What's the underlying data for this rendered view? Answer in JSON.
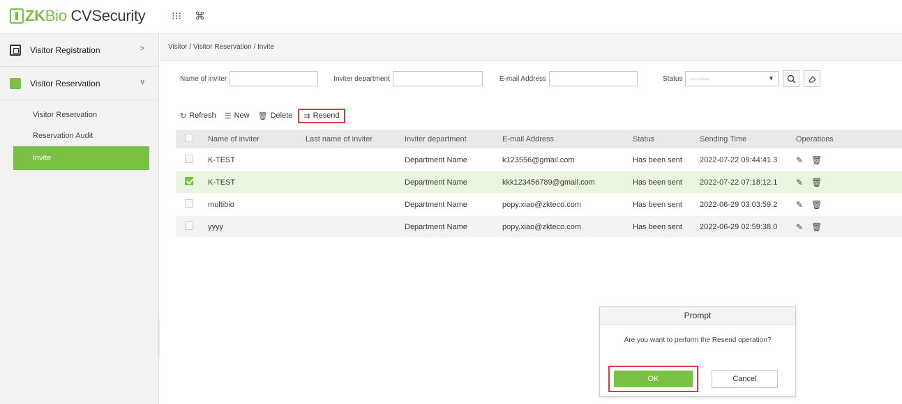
{
  "app": {
    "logo_prefix": "ZK",
    "logo_bio": "Bio",
    "logo_suffix": " CVSecurity"
  },
  "topbar": {
    "apps_icon": "⁝⁝⁝",
    "cmd_icon": "⌘"
  },
  "sidebar": {
    "groups": [
      {
        "label": "Visitor Registration",
        "chevron": ">"
      },
      {
        "label": "Visitor Reservation",
        "chevron": "v"
      }
    ],
    "items": [
      {
        "label": "Visitor Reservation"
      },
      {
        "label": "Reservation Audit"
      },
      {
        "label": "Invite"
      }
    ],
    "collapse": "<"
  },
  "breadcrumb": "Visitor / Visitor Reservation / Invite",
  "filters": {
    "name_label": "Name of inviter",
    "dept_label": "Inviter department",
    "email_label": "E-mail Address",
    "status_label": "Status",
    "status_value": "---------"
  },
  "toolbar": {
    "refresh": "Refresh",
    "new": "New",
    "delete": "Delete",
    "resend": "Resend"
  },
  "table": {
    "headers": [
      "Name of inviter",
      "Last name of inviter",
      "Inviter department",
      "E-mail Address",
      "Status",
      "Sending Time",
      "Operations"
    ],
    "rows": [
      {
        "name": "K-TEST",
        "last": "",
        "dept": "Department Name",
        "email": "k123556@gmail.com",
        "status": "Has been sent",
        "time": "2022-07-22 09:44:41.3",
        "checked": false
      },
      {
        "name": "K-TEST",
        "last": "",
        "dept": "Department Name",
        "email": "kkk123456789@gmail.com",
        "status": "Has been sent",
        "time": "2022-07-22 07:18:12.1",
        "checked": true
      },
      {
        "name": "multibio",
        "last": "",
        "dept": "Department Name",
        "email": "popy.xiao@zkteco.com",
        "status": "Has been sent",
        "time": "2022-06-29 03:03:59.2",
        "checked": false
      },
      {
        "name": "yyyy",
        "last": "",
        "dept": "Department Name",
        "email": "popy.xiao@zkteco.com",
        "status": "Has been sent",
        "time": "2022-06-29 02:59:38.0",
        "checked": false
      }
    ]
  },
  "dialog": {
    "title": "Prompt",
    "message": "Are you want to perform the Resend operation?",
    "ok": "OK",
    "cancel": "Cancel"
  },
  "colors": {
    "accent": "#7ac143",
    "highlight": "#e03b3b"
  }
}
